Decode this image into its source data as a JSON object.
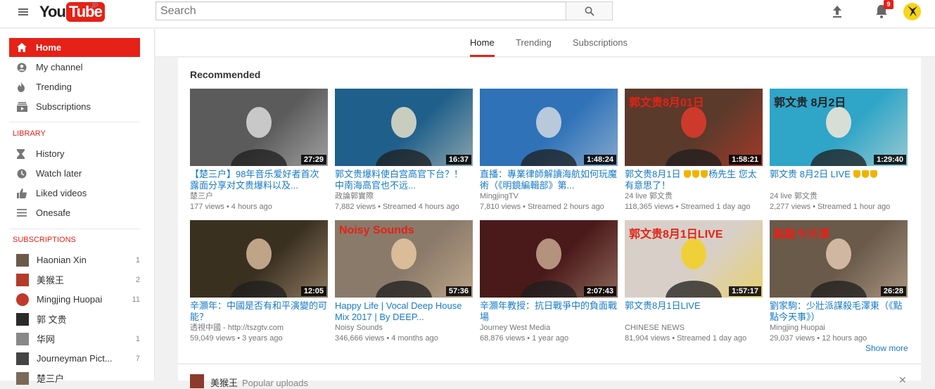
{
  "header": {
    "logo_you": "You",
    "logo_tube": "Tube",
    "logo_region": "JP",
    "search_placeholder": "Search",
    "notification_count": "9"
  },
  "tabs": [
    {
      "label": "Home",
      "active": true
    },
    {
      "label": "Trending",
      "active": false
    },
    {
      "label": "Subscriptions",
      "active": false
    }
  ],
  "sidebar": {
    "main": [
      {
        "label": "Home",
        "icon": "home-icon",
        "active": true
      },
      {
        "label": "My channel",
        "icon": "person-icon"
      },
      {
        "label": "Trending",
        "icon": "flame-icon"
      },
      {
        "label": "Subscriptions",
        "icon": "subscriptions-icon"
      }
    ],
    "library_heading": "LIBRARY",
    "library": [
      {
        "label": "History",
        "icon": "hourglass-icon"
      },
      {
        "label": "Watch later",
        "icon": "clock-icon"
      },
      {
        "label": "Liked videos",
        "icon": "thumbs-up-icon"
      },
      {
        "label": "Onesafe",
        "icon": "playlist-icon"
      }
    ],
    "subscriptions_heading": "SUBSCRIPTIONS",
    "subscriptions": [
      {
        "label": "Haonian Xin",
        "count": "1",
        "color": "#6b5a4a"
      },
      {
        "label": "美猴王",
        "count": "2",
        "color": "#b23b2b"
      },
      {
        "label": "Mingjing Huopai",
        "count": "11",
        "color": "#c0392b"
      },
      {
        "label": "郭 文贵",
        "count": "",
        "color": "#2a2a2a"
      },
      {
        "label": "华网",
        "count": "1",
        "color": "#888888"
      },
      {
        "label": "Journeyman Pict...",
        "count": "7",
        "color": "#444444"
      },
      {
        "label": "楚三户",
        "count": "",
        "color": "#7a6a5a"
      }
    ]
  },
  "feed": {
    "section_title": "Recommended",
    "show_more": "Show more",
    "videos": [
      {
        "title": "【楚三户】98年音乐爱好者首次露面分享对文贵爆料以及...",
        "channel": "楚三户",
        "views": "177 views",
        "age": "4 hours ago",
        "duration": "27:29",
        "bg": "#5b5b5b",
        "accent": "#dcdcdc"
      },
      {
        "title": "郭文贵爆料使白宫高官下台？！ 中南海高官也不远...",
        "channel": "政論郭實際",
        "views": "7,882 views",
        "age": "Streamed 4 hours ago",
        "duration": "16:37",
        "bg": "#1f5f8b",
        "accent": "#e8e0c8"
      },
      {
        "title": "直播：專業律師解讀海航如何玩魔術（《明鏡編輯部》第...",
        "channel": "MingjingTV",
        "views": "7,810 views",
        "age": "Streamed 2 hours ago",
        "duration": "1:48:24",
        "bg": "#2f72b8",
        "accent": "#cfd8e0"
      },
      {
        "title": "郭文贵8月1日 🛡🛡🛡杨先生 您太有意思了！",
        "title_plain": "郭文贵8月1日",
        "title_rest": "杨先生 您太有意思了！",
        "badges": 3,
        "channel": "24 live 郭文贵",
        "views": "118,365 views",
        "age": "Streamed 1 day ago",
        "duration": "1:58:21",
        "bg": "#5a3a2a",
        "accent": "#e23b2b",
        "overlay": "郭文贵8月01日"
      },
      {
        "title": "郭文贵 8月2日 LIVE",
        "title_plain": "郭文贵 8月2日 LIVE",
        "title_rest": "",
        "badges": 3,
        "channel": "24 live 郭文贵",
        "views": "2,277 views",
        "age": "Streamed 1 hour ago",
        "duration": "1:29:40",
        "bg": "#2fa5c8",
        "accent": "#f5e8d8",
        "overlay": "郭文贵 8月2日"
      },
      {
        "title": "辛灝年：中國是否有和平演變的可能？",
        "channel": "透視中國 - http://tszgtv.com",
        "views": "59,049 views",
        "age": "3 years ago",
        "duration": "12:05",
        "bg": "#3a3020",
        "accent": "#d8b89a"
      },
      {
        "title": "Happy Life | Vocal Deep House Mix 2017 | By DEEP...",
        "channel": "Noisy Sounds",
        "views": "346,666 views",
        "age": "4 months ago",
        "duration": "57:36",
        "bg": "#8a7a6a",
        "accent": "#e8c8a0",
        "overlay": "Noisy Sounds"
      },
      {
        "title": "辛灝年教授：抗日戰爭中的負面戰場",
        "channel": "Journey West Media",
        "views": "68,876 views",
        "age": "1 year ago",
        "duration": "2:07:43",
        "bg": "#4a1a1a",
        "accent": "#c8a890"
      },
      {
        "title": "郭文贵8月1日LIVE",
        "channel": "CHINESE NEWS",
        "views": "81,904 views",
        "age": "Streamed 1 day ago",
        "duration": "1:57:17",
        "bg": "#d8d0c8",
        "accent": "#f5d020",
        "overlay": "郭文贵8月1日LIVE"
      },
      {
        "title": "劉家駒：少壯派謀殺毛澤東（《點點今天事》）",
        "channel": "Mingjing Huopai",
        "views": "29,037 views",
        "age": "12 hours ago",
        "duration": "26:28",
        "bg": "#6a5a4a",
        "accent": "#e0c8b0",
        "overlay": "點點今天事"
      }
    ]
  },
  "next_section": {
    "title": "美猴王",
    "subtitle": "Popular uploads",
    "close": "✕"
  },
  "colors": {
    "brand": "#e62117",
    "link": "#167ac6"
  }
}
